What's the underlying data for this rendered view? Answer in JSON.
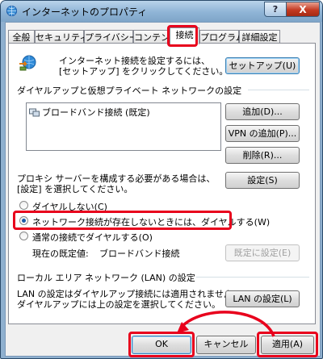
{
  "window": {
    "title": "インターネットのプロパティ",
    "help_label": "?",
    "close_label": "X"
  },
  "tabs": [
    {
      "label": "全般"
    },
    {
      "label": "セキュリティ"
    },
    {
      "label": "プライバシー"
    },
    {
      "label": "コンテンツ"
    },
    {
      "label": "接続"
    },
    {
      "label": "プログラム"
    },
    {
      "label": "詳細設定"
    }
  ],
  "active_tab": "接続",
  "setup": {
    "text_line1": "インターネット接続を設定するには、",
    "text_line2": "[セットアップ] をクリックしてください。",
    "button": "セットアップ(U)"
  },
  "dialup": {
    "heading": "ダイヤルアップと仮想プライベート ネットワークの設定",
    "connections": [
      "ブロードバンド接続 (既定)"
    ],
    "add_button": "追加(D)...",
    "vpn_button": "VPN の追加(P)...",
    "remove_button": "削除(R)...",
    "proxy_text_line1": "プロキシ サーバーを構成する必要がある場合は、",
    "proxy_text_line2": "[設定] を選択してください。",
    "settings_button": "設定(S)",
    "options": [
      {
        "label": "ダイヤルしない(C)",
        "checked": false
      },
      {
        "label": "ネットワーク接続が存在しないときには、ダイヤルする(W)",
        "checked": true
      },
      {
        "label": "通常の接続でダイヤルする(O)",
        "checked": false
      }
    ],
    "default_label": "現在の既定値:",
    "default_value": "ブロードバンド接続",
    "set_default_button": "既定に設定(E)"
  },
  "lan": {
    "heading": "ローカル エリア ネットワーク (LAN) の設定",
    "text_line1": "LAN の設定はダイヤルアップ接続には適用されません。",
    "text_line2": "ダイヤルアップには上の設定を選択してください。",
    "button": "LAN の設定(L)"
  },
  "footer": {
    "ok": "OK",
    "cancel": "キャンセル",
    "apply": "適用(A)"
  },
  "highlight_color": "#e8001c"
}
